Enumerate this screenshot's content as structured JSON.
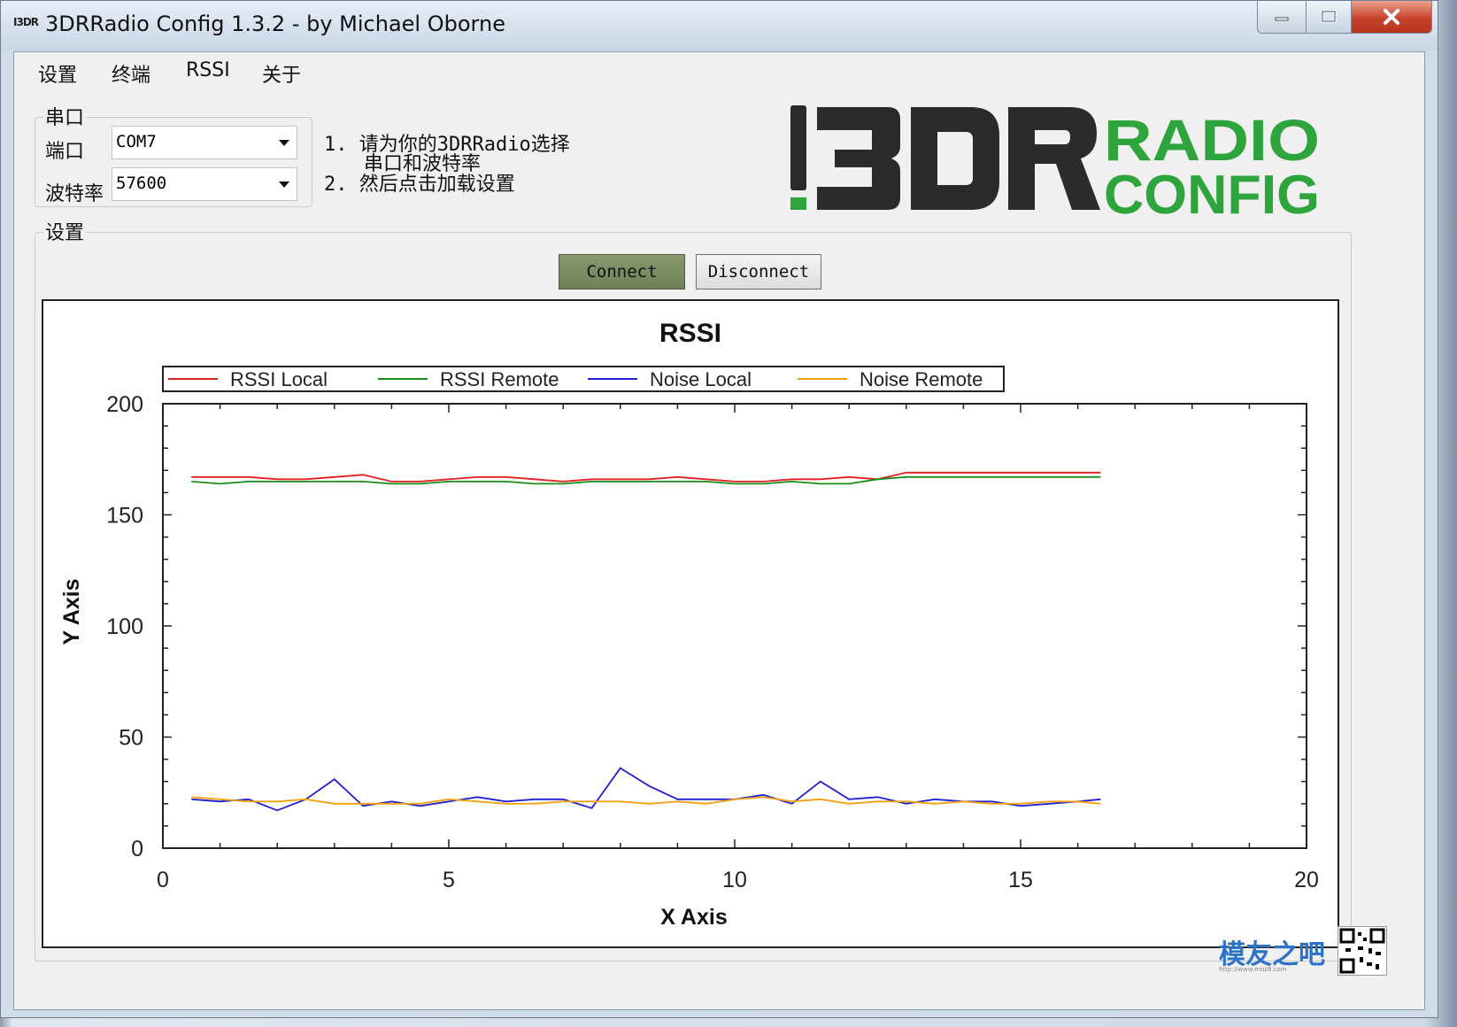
{
  "window": {
    "icon_text": "I3DR",
    "title": "3DRRadio Config 1.3.2 - by Michael Oborne",
    "controls": {
      "minimize": "minimize",
      "maximize": "maximize",
      "close": "close"
    }
  },
  "menu": [
    "设置",
    "终端",
    "RSSI",
    "关于"
  ],
  "serial": {
    "group_label": "串口",
    "port_label": "端口",
    "port_value": "COM7",
    "baud_label": "波特率",
    "baud_value": "57600"
  },
  "instructions": {
    "line1": "1. 请为你的3DRRadio选择",
    "line1b": "串口和波特率",
    "line2": "2. 然后点击加载设置"
  },
  "logo": {
    "part1": "!3DR",
    "part2": "RADIO",
    "part3": "CONFIG"
  },
  "settings_group_label": "设置",
  "buttons": {
    "connect": "Connect",
    "disconnect": "Disconnect"
  },
  "colors": {
    "rssi_local": "#e02020",
    "rssi_remote": "#1a8c1a",
    "noise_local": "#2020d0",
    "noise_remote": "#f0a010",
    "logo_dark": "#2b2b2b",
    "logo_green": "#2ea43c"
  },
  "chart_data": {
    "type": "line",
    "title": "RSSI",
    "xlabel": "X Axis",
    "ylabel": "Y Axis",
    "xlim": [
      0,
      20
    ],
    "ylim": [
      0,
      200
    ],
    "xticks": [
      0,
      5,
      10,
      15,
      20
    ],
    "yticks": [
      0,
      50,
      100,
      150,
      200
    ],
    "legend_position": "top",
    "x": [
      0.5,
      1.0,
      1.5,
      2.0,
      2.5,
      3.0,
      3.5,
      4.0,
      4.5,
      5.0,
      5.5,
      6.0,
      6.5,
      7.0,
      7.5,
      8.0,
      8.5,
      9.0,
      9.5,
      10.0,
      10.5,
      11.0,
      11.5,
      12.0,
      12.5,
      13.0,
      13.5,
      14.0,
      14.5,
      15.0,
      15.5,
      16.0,
      16.4
    ],
    "series": [
      {
        "name": "RSSI Local",
        "values": [
          167,
          167,
          167,
          166,
          166,
          167,
          168,
          165,
          165,
          166,
          167,
          167,
          166,
          165,
          166,
          166,
          166,
          167,
          166,
          165,
          165,
          166,
          166,
          167,
          166,
          169,
          169,
          169,
          169,
          169,
          169,
          169,
          169
        ]
      },
      {
        "name": "RSSI Remote",
        "values": [
          165,
          164,
          165,
          165,
          165,
          165,
          165,
          164,
          164,
          165,
          165,
          165,
          164,
          164,
          165,
          165,
          165,
          165,
          165,
          164,
          164,
          165,
          164,
          164,
          166,
          167,
          167,
          167,
          167,
          167,
          167,
          167,
          167
        ]
      },
      {
        "name": "Noise Local",
        "values": [
          22,
          21,
          22,
          17,
          22,
          31,
          19,
          21,
          19,
          21,
          23,
          21,
          22,
          22,
          18,
          36,
          28,
          22,
          22,
          22,
          24,
          20,
          30,
          22,
          23,
          20,
          22,
          21,
          21,
          19,
          20,
          21,
          22
        ]
      },
      {
        "name": "Noise Remote",
        "values": [
          23,
          22,
          21,
          21,
          22,
          20,
          20,
          20,
          20,
          22,
          21,
          20,
          20,
          21,
          21,
          21,
          20,
          21,
          20,
          22,
          23,
          21,
          22,
          20,
          21,
          21,
          20,
          21,
          20,
          20,
          21,
          21,
          20
        ]
      }
    ]
  },
  "watermark": {
    "text": "模友之吧",
    "small": "http://www.moz8.com"
  }
}
